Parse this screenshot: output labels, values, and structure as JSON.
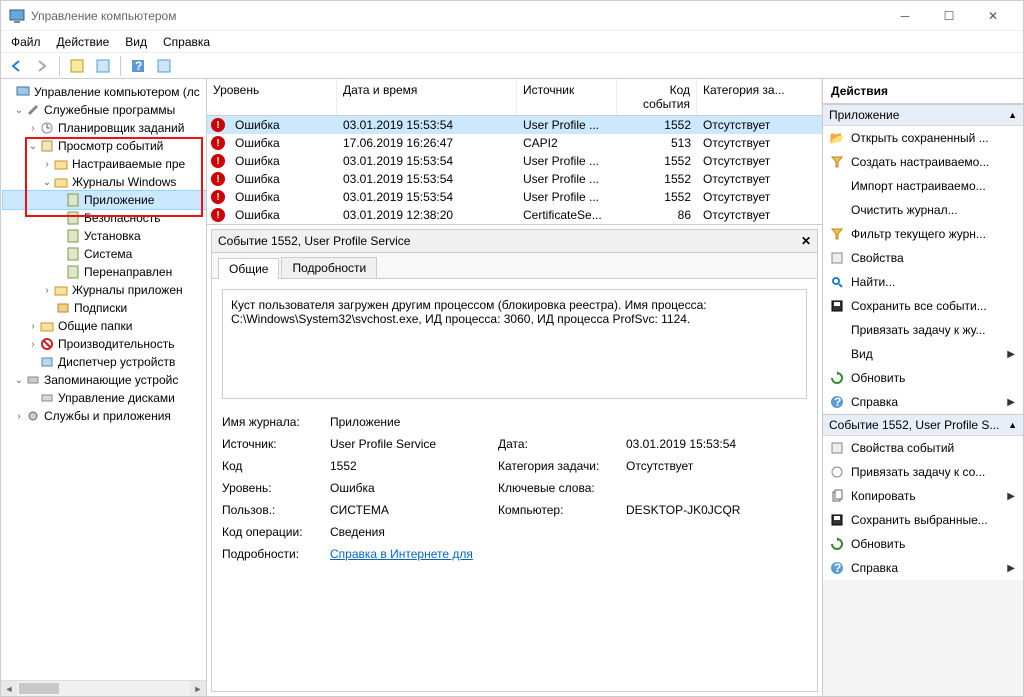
{
  "title": "Управление компьютером",
  "menu": {
    "file": "Файл",
    "action": "Действие",
    "view": "Вид",
    "help": "Справка"
  },
  "tree": {
    "root": "Управление компьютером (лс",
    "sysTools": "Служебные программы",
    "taskSched": "Планировщик заданий",
    "eventViewer": "Просмотр событий",
    "customViews": "Настраиваемые пре",
    "winLogs": "Журналы Windows",
    "app": "Приложение",
    "security": "Безопасность",
    "setup": "Установка",
    "system": "Система",
    "forwarded": "Перенаправлен",
    "appLogs": "Журналы приложен",
    "subs": "Подписки",
    "shared": "Общие папки",
    "perf": "Производительность",
    "devmgr": "Диспетчер устройств",
    "storage": "Запоминающие устройс",
    "diskmgr": "Управление дисками",
    "services": "Службы и приложения"
  },
  "grid": {
    "cols": {
      "level": "Уровень",
      "datetime": "Дата и время",
      "source": "Источник",
      "eventId": "Код события",
      "category": "Категория за..."
    },
    "rows": [
      {
        "level": "Ошибка",
        "dt": "03.01.2019 15:53:54",
        "src": "User Profile ...",
        "id": "1552",
        "cat": "Отсутствует"
      },
      {
        "level": "Ошибка",
        "dt": "17.06.2019 16:26:47",
        "src": "CAPI2",
        "id": "513",
        "cat": "Отсутствует"
      },
      {
        "level": "Ошибка",
        "dt": "03.01.2019 15:53:54",
        "src": "User Profile ...",
        "id": "1552",
        "cat": "Отсутствует"
      },
      {
        "level": "Ошибка",
        "dt": "03.01.2019 15:53:54",
        "src": "User Profile ...",
        "id": "1552",
        "cat": "Отсутствует"
      },
      {
        "level": "Ошибка",
        "dt": "03.01.2019 15:53:54",
        "src": "User Profile ...",
        "id": "1552",
        "cat": "Отсутствует"
      },
      {
        "level": "Ошибка",
        "dt": "03.01.2019 12:38:20",
        "src": "CertificateSe...",
        "id": "86",
        "cat": "Отсутствует"
      }
    ]
  },
  "detail": {
    "title": "Событие 1552, User Profile Service",
    "tabs": {
      "general": "Общие",
      "details": "Подробности"
    },
    "description": "Куст пользователя загружен другим процессом (блокировка реестра). Имя процесса: C:\\Windows\\System32\\svchost.exe, ИД процесса: 3060, ИД процесса ProfSvc: 1124.",
    "props": {
      "logNameK": "Имя журнала:",
      "logNameV": "Приложение",
      "sourceK": "Источник:",
      "sourceV": "User Profile Service",
      "dateK": "Дата:",
      "dateV": "03.01.2019 15:53:54",
      "codeK": "Код",
      "codeV": "1552",
      "catK": "Категория задачи:",
      "catV": "Отсутствует",
      "levelK": "Уровень:",
      "levelV": "Ошибка",
      "keysK": "Ключевые слова:",
      "keysV": "",
      "userK": "Пользов.:",
      "userV": "СИСТЕМА",
      "compK": "Компьютер:",
      "compV": "DESKTOP-JK0JCQR",
      "opK": "Код операции:",
      "opV": "Сведения",
      "detK": "Подробности:",
      "detV": "Справка в Интернете для"
    }
  },
  "actions": {
    "head": "Действия",
    "sec1": "Приложение",
    "sec2": "Событие 1552, User Profile S...",
    "items1": {
      "openSaved": "Открыть сохраненный ...",
      "createCustom": "Создать настраиваемо...",
      "importCustom": "Импорт настраиваемо...",
      "clearLog": "Очистить журнал...",
      "filterLog": "Фильтр текущего журн...",
      "properties": "Свойства",
      "find": "Найти...",
      "saveAll": "Сохранить все событи...",
      "attachTask": "Привязать задачу к жу...",
      "view": "Вид",
      "refresh": "Обновить",
      "help": "Справка"
    },
    "items2": {
      "evtProps": "Свойства событий",
      "attachTask2": "Привязать задачу к со...",
      "copy": "Копировать",
      "saveSel": "Сохранить выбранные...",
      "refresh2": "Обновить",
      "help2": "Справка"
    }
  }
}
